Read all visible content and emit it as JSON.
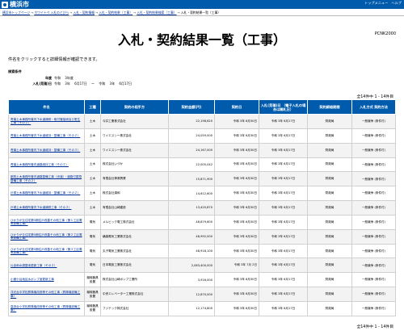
{
  "header": {
    "logo_text": "横浜市",
    "links": [
      "トップメニュー",
      "ヘルプ"
    ],
    "sitemap": "サイトマップ"
  },
  "breadcrumb": {
    "items": [
      "横浜市トップページ",
      "ホワイトペ 入札のとびら",
      "入札・契約情報",
      "入札・契約結果（工事）",
      "入札・契約結果検索（工事）"
    ],
    "current": "入札・契約結果一覧（工事）"
  },
  "page": {
    "title": "入札・契約結果一覧（工事）",
    "code": "PCNK2000",
    "intro": "件名をクリックすると詳細情報が確認できます。"
  },
  "conditions": {
    "title": "検索条件",
    "year_label": "年度",
    "year_value": "令和 　3年度",
    "date_label": "入札(見積)日",
    "date_value": "令和 　3年 　6月17日 　～ 　令和 　3年 　6月17日"
  },
  "count_text": "全14件中 1 - 14件目",
  "table": {
    "headers": [
      "件名",
      "工種",
      "契約の相手方",
      "契約金額(円)",
      "契約日",
      "入札(見積)日 （電子入札の場合は開札日）",
      "契約締結期間",
      "入札方式 契約方法"
    ],
    "rows": [
      {
        "name": "青葉土木事務所管内下水道補修・取付管接続及び更生工事（その２）",
        "type": "土木",
        "company": "今井工業株式会社",
        "amount": "22,198,620",
        "contract_date": "令和 3年 6月30日",
        "bid_date": "令和 3年 6月17日",
        "period": "財政局",
        "method": "一般競争 (条件付)"
      },
      {
        "name": "青葉土木事務所管内下水道維持・整備工事（その２）",
        "type": "土木",
        "company": "ワイエスシー株式会社",
        "amount": "24,059,000",
        "contract_date": "令和 3年 6月30日",
        "bid_date": "令和 3年 6月17日",
        "period": "財政局",
        "method": "一般競争 (条件付)"
      },
      {
        "name": "青葉土木事務所管内下水道維持・整備工事（その３）",
        "type": "土木",
        "company": "ワイエスシー株式会社",
        "amount": "24,167,000",
        "contract_date": "令和 3年 6月30日",
        "bid_date": "令和 3年 6月17日",
        "period": "財政局",
        "method": "一般競争 (条件付)"
      },
      {
        "name": "青葉土木事務所管内道路維持工事（その２）",
        "type": "土木",
        "company": "株式会社いづか",
        "amount": "22,005,042",
        "contract_date": "令和 3年 6月30日",
        "bid_date": "令和 3年 6月17日",
        "period": "財政局",
        "method": "一般競争 (条件付)"
      },
      {
        "name": "都筑土木事務所管内道路整備工事（歩道）・道路付属物整備工事（その２）",
        "type": "土木",
        "company": "有限会社神原興業",
        "amount": "15,871,900",
        "contract_date": "令和 3年 6月30日",
        "bid_date": "令和 3年 6月17日",
        "period": "財政局",
        "method": "一般競争 (条件付)"
      },
      {
        "name": "戸塚土木事務所管内下水道維持・整備工事（その２）",
        "type": "土木",
        "company": "株式会社湊和",
        "amount": "14,612,600",
        "contract_date": "令和 3年 6月30日",
        "bid_date": "令和 3年 6月17日",
        "period": "財政局",
        "method": "一般競争 (条件付)"
      },
      {
        "name": "戸塚土木事務所管内下水道補修工事（その２）",
        "type": "土木",
        "company": "有限会社山崎建設",
        "amount": "13,420,870",
        "contract_date": "令和 3年 6月30日",
        "bid_date": "令和 3年 6月17日",
        "period": "財政局",
        "method": "一般競争 (条件付)"
      },
      {
        "name": "ひかりが丘住宅第5期住戸改善その他工事（第１工区電気設備工事）",
        "type": "電気",
        "company": "メルビック電工株式会社",
        "amount": "48,879,600",
        "contract_date": "令和 3年 6月30日",
        "bid_date": "令和 3年 6月17日",
        "period": "財政局",
        "method": "一般競争 (条件付)"
      },
      {
        "name": "ひかりが丘住宅第5期住戸改善その他工事（第２工区電気設備工事）",
        "type": "電気",
        "company": "横森電気工業株式会社",
        "amount": "48,992,000",
        "contract_date": "令和 3年 6月30日",
        "bid_date": "令和 3年 6月17日",
        "period": "財政局",
        "method": "一般競争 (条件付)"
      },
      {
        "name": "ひかりが丘住宅第5期住戸改善その他工事（第３工区電気設備工事）",
        "type": "電気",
        "company": "丸子電気工業株式会社",
        "amount": "48,918,100",
        "contract_date": "令和 3年 6月30日",
        "bid_date": "令和 3年 6月17日",
        "period": "財政局",
        "method": "一般競争 (条件付)"
      },
      {
        "name": "片倉雨水調整池更新工事（その２）",
        "type": "電気",
        "company": "日本電設工業株式会社",
        "amount": "2,083,400,000",
        "contract_date": "令和 3年 7月 2日",
        "bid_date": "令和 3年 6月17日",
        "period": "財政局",
        "method": "一般競争 (条件付)"
      },
      {
        "name": "小菅ケ谷地区水ポンプ室更新工事",
        "type": "機械器具設置",
        "company": "株式会社山崎ポンプ工業所",
        "amount": "3,916,000",
        "contract_date": "令和 3年 6月30日",
        "bid_date": "令和 3年 6月17日",
        "period": "財政局",
        "method": "一般競争 (条件付)"
      },
      {
        "name": "洋光台中学校昇降機改修等その他工事（昇降機設備工事）",
        "type": "機械器具設置",
        "company": "中央エレベーター工業株式会社",
        "amount": "12,870,000",
        "contract_date": "令和 3年 6月30日",
        "bid_date": "令和 3年 6月17日",
        "period": "財政局",
        "method": "一般競争 (条件付)"
      },
      {
        "name": "高田台小学校昇降機改修等その他工事（昇降機設備工事）",
        "type": "機械器具設置",
        "company": "フジテック株式会社",
        "amount": "12,174,800",
        "contract_date": "令和 3年 6月30日",
        "bid_date": "令和 3年 6月17日",
        "period": "財政局",
        "method": "一般競争 (条件付)"
      }
    ]
  }
}
